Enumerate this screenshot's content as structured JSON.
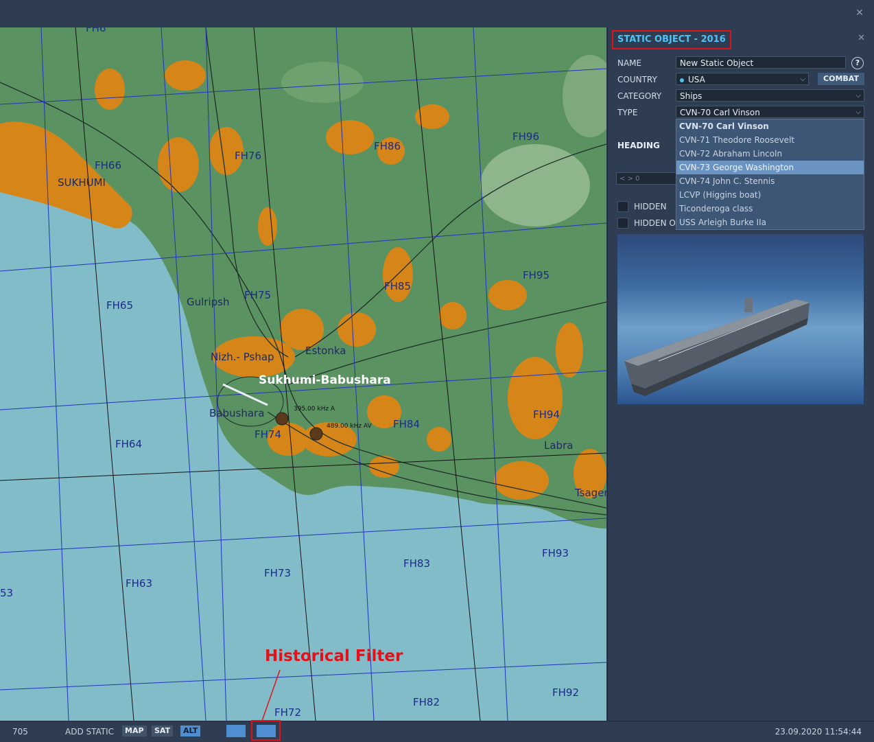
{
  "panel": {
    "title": "STATIC OBJECT - 2016",
    "name_label": "NAME",
    "name_value": "New Static Object",
    "country_label": "COUNTRY",
    "country_value": "USA",
    "combat_label": "COMBAT",
    "category_label": "CATEGORY",
    "category_value": "Ships",
    "type_label": "TYPE",
    "type_value": "CVN-70 Carl Vinson",
    "heading_label": "HEADING",
    "heading_value": "0",
    "hidden_label": "HIDDEN",
    "hidden_on_label": "HIDDEN O",
    "help_symbol": "?",
    "type_options": [
      "CVN-70 Carl Vinson",
      "CVN-71 Theodore Roosevelt",
      "CVN-72 Abraham Lincoln",
      "CVN-73 George Washington",
      "CVN-74 John C. Stennis",
      "LCVP (Higgins boat)",
      "Ticonderoga class",
      "USS Arleigh Burke IIa"
    ],
    "type_options_highlighted": "CVN-73 George Washington"
  },
  "map": {
    "grid_labels": [
      "FH76",
      "FH66",
      "FH86",
      "FH96",
      "FH65",
      "FH75",
      "FH85",
      "FH95",
      "FH64",
      "FH74",
      "FH84",
      "FH94",
      "FH63",
      "FH73",
      "FH83",
      "FH93",
      "FH72",
      "FH82",
      "FH92",
      "53",
      "FH6"
    ],
    "towns": [
      "SUKHUMI",
      "Gulripsh",
      "Nizh.- Pshap",
      "Estonka",
      "Babushara",
      "Labra",
      "Tsager"
    ],
    "airfield": "Sukhumi-Babushara",
    "beacons": [
      "395.00 kHz A",
      "489.00 kHz AV"
    ]
  },
  "annotation": {
    "label": "Historical Filter"
  },
  "statusbar": {
    "left_number": "705",
    "add_static": "ADD STATIC",
    "map_btn": "MAP",
    "sat_btn": "SAT",
    "alt_btn": "ALT",
    "datetime": "23.09.2020 11:54:44"
  },
  "colors": {
    "sea": "#81bcc8",
    "land": "#5b9262",
    "urban": "#d68618",
    "panel_bg": "#2e3d51",
    "accent": "#4fc3f5",
    "annotation": "#e0121a"
  }
}
